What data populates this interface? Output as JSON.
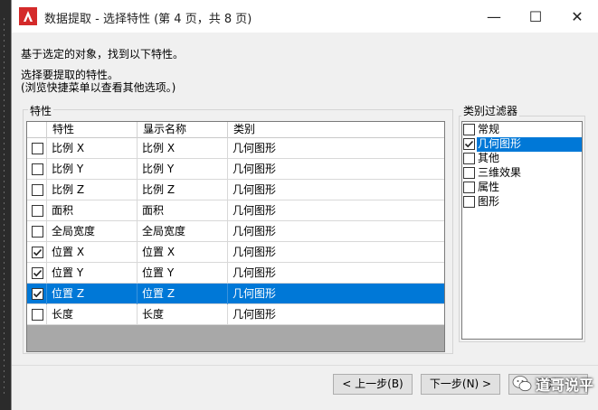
{
  "window": {
    "title": "数据提取 - 选择特性 (第 4 页，共 8 页)",
    "controls": {
      "minimize": "—",
      "maximize": "☐",
      "close": "✕"
    }
  },
  "intro": {
    "line1": "基于选定的对象，找到以下特性。",
    "line2": "选择要提取的特性。",
    "line3": "(浏览快捷菜单以查看其他选项。)"
  },
  "properties_group": {
    "legend": "特性",
    "columns": [
      "特性",
      "显示名称",
      "类别"
    ],
    "rows": [
      {
        "checked": false,
        "property": "比例 X",
        "display": "比例 X",
        "category": "几何图形",
        "selected": false
      },
      {
        "checked": false,
        "property": "比例 Y",
        "display": "比例 Y",
        "category": "几何图形",
        "selected": false
      },
      {
        "checked": false,
        "property": "比例 Z",
        "display": "比例 Z",
        "category": "几何图形",
        "selected": false
      },
      {
        "checked": false,
        "property": "面积",
        "display": "面积",
        "category": "几何图形",
        "selected": false
      },
      {
        "checked": false,
        "property": "全局宽度",
        "display": "全局宽度",
        "category": "几何图形",
        "selected": false
      },
      {
        "checked": true,
        "property": "位置 X",
        "display": "位置 X",
        "category": "几何图形",
        "selected": false
      },
      {
        "checked": true,
        "property": "位置 Y",
        "display": "位置 Y",
        "category": "几何图形",
        "selected": false
      },
      {
        "checked": true,
        "property": "位置 Z",
        "display": "位置 Z",
        "category": "几何图形",
        "selected": true
      },
      {
        "checked": false,
        "property": "长度",
        "display": "长度",
        "category": "几何图形",
        "selected": false
      }
    ]
  },
  "category_filter": {
    "legend": "类别过滤器",
    "items": [
      {
        "label": "常规",
        "checked": false,
        "selected": false
      },
      {
        "label": "几何图形",
        "checked": true,
        "selected": true
      },
      {
        "label": "其他",
        "checked": false,
        "selected": false
      },
      {
        "label": "三维效果",
        "checked": false,
        "selected": false
      },
      {
        "label": "属性",
        "checked": false,
        "selected": false
      },
      {
        "label": "图形",
        "checked": false,
        "selected": false
      }
    ]
  },
  "buttons": {
    "prev": "< 上一步(B)",
    "next": "下一步(N) >",
    "cancel": "取消"
  },
  "watermark": {
    "text": "道哥说平"
  },
  "colors": {
    "accent": "#0078d7",
    "app_icon": "#d42a2a"
  }
}
